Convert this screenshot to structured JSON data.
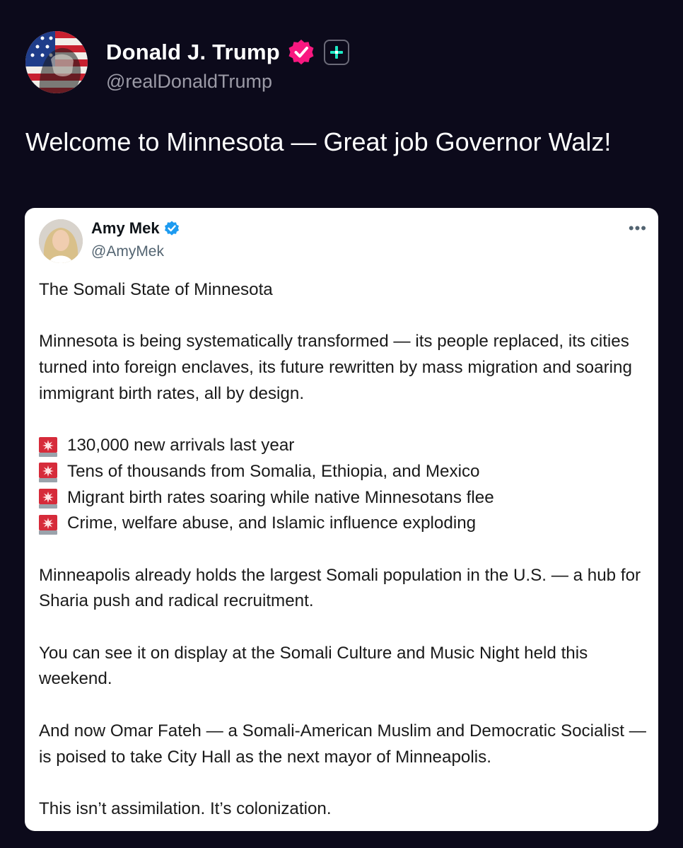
{
  "post": {
    "author": {
      "display_name": "Donald J. Trump",
      "handle": "@realDonaldTrump",
      "verified_color": "#f91880",
      "avatar_icon": "flag-portrait-avatar"
    },
    "text": "Welcome to Minnesota — Great job Governor Walz!"
  },
  "quote": {
    "author": {
      "display_name": "Amy Mek",
      "handle": "@AmyMek",
      "verified_color": "#1d9bf0"
    },
    "more_label": "•••",
    "title": "The Somali State of Minnesota",
    "paragraph1": "Minnesota is being systematically transformed — its people replaced, its cities turned into foreign enclaves, its future rewritten by mass migration and soaring immigrant birth rates, all by design.",
    "bullets": [
      "130,000 new arrivals last year",
      "Tens of thousands from Somalia, Ethiopia, and Mexico",
      "Migrant birth rates soaring while native Minnesotans flee",
      "Crime, welfare abuse, and Islamic influence exploding"
    ],
    "bullet_icon": "rotating-light-icon",
    "paragraph2": "Minneapolis already holds the largest Somali population in the U.S. — a hub for Sharia push and radical recruitment.",
    "paragraph3": "You can see it on display at the Somali Culture and Music Night held this weekend.",
    "paragraph4": "And now Omar Fateh — a Somali-American Muslim and Democratic Socialist — is poised to take City Hall as the next mayor of Minneapolis.",
    "paragraph5": "This isn’t assimilation. It’s colonization."
  }
}
